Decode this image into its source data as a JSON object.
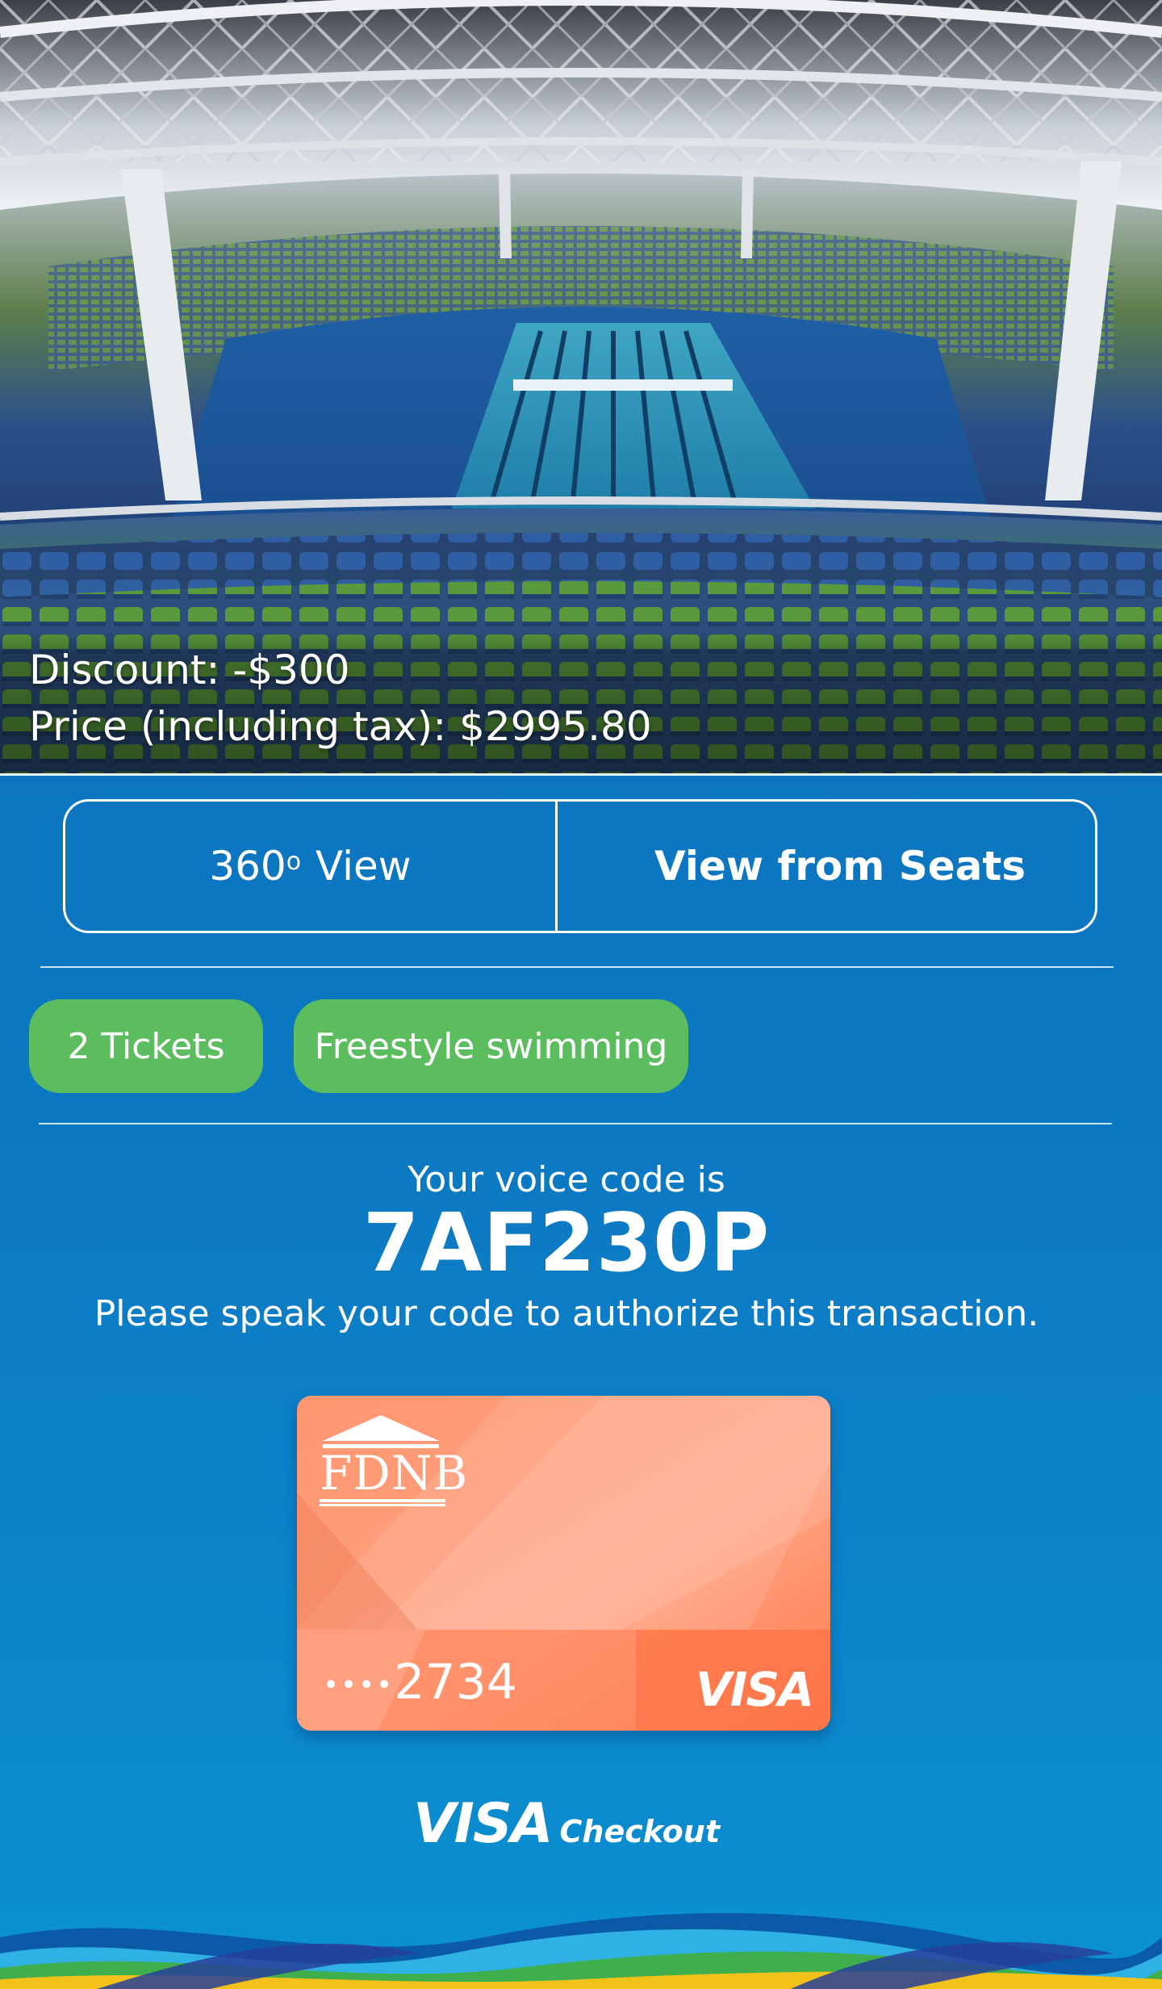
{
  "hero": {
    "discount": "Discount: -$300",
    "price": "Price (including tax): $2995.80"
  },
  "view_toggle": {
    "option_360_number": "360",
    "option_360_suffix": "View",
    "option_seats": "View from Seats",
    "selected": "View from Seats"
  },
  "chips": {
    "tickets": "2 Tickets",
    "event": "Freestyle swimming"
  },
  "voice": {
    "label": "Your voice code is",
    "code": "7AF230P",
    "instruction": "Please speak your code to authorize this transaction."
  },
  "card": {
    "bank": "FDNB",
    "masked_dots": "••••",
    "last4": "2734",
    "network": "VISA",
    "color": "#ff8a63"
  },
  "footer_brand": {
    "visa": "VISA",
    "checkout": "Checkout"
  },
  "colors": {
    "background": "#0c78c2",
    "chip": "#5cbd5e",
    "card": "#ff8a63"
  },
  "icons": {
    "bank": "bank-building-icon",
    "degree": "degree-symbol"
  }
}
